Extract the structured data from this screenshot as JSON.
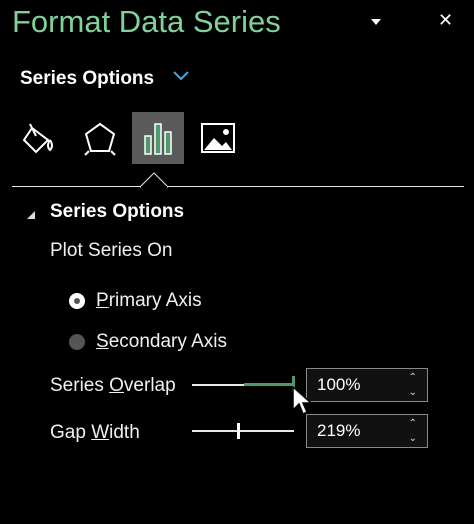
{
  "panel": {
    "title": "Format Data Series",
    "menu_icon": "dropdown-caret-icon",
    "close_label": "✕"
  },
  "options_dropdown": {
    "label": "Series Options"
  },
  "tabs": [
    {
      "name": "fill-and-line",
      "icon": "paint-bucket-icon"
    },
    {
      "name": "effects",
      "icon": "pentagon-icon"
    },
    {
      "name": "series-options",
      "icon": "bar-chart-icon",
      "selected": true
    },
    {
      "name": "picture",
      "icon": "picture-icon"
    }
  ],
  "group": {
    "label": "Series Options",
    "plot_on_label": "Plot Series On",
    "primary": {
      "label": "Primary Axis",
      "underline": "P",
      "rest": "rimary Axis",
      "checked": true
    },
    "secondary": {
      "label": "Secondary Axis",
      "underline": "S",
      "rest": "econdary Axis",
      "checked": false
    }
  },
  "overlap": {
    "pre": "Series ",
    "underline": "O",
    "post": "verlap",
    "value": "100%",
    "fraction": 1.0
  },
  "gap": {
    "pre": "Gap ",
    "underline": "W",
    "post": "idth",
    "value": "219%",
    "fraction": 0.438
  },
  "colors": {
    "title": "#7fd39a",
    "accent": "#4f9a6c",
    "chev": "#4aa3e0"
  }
}
